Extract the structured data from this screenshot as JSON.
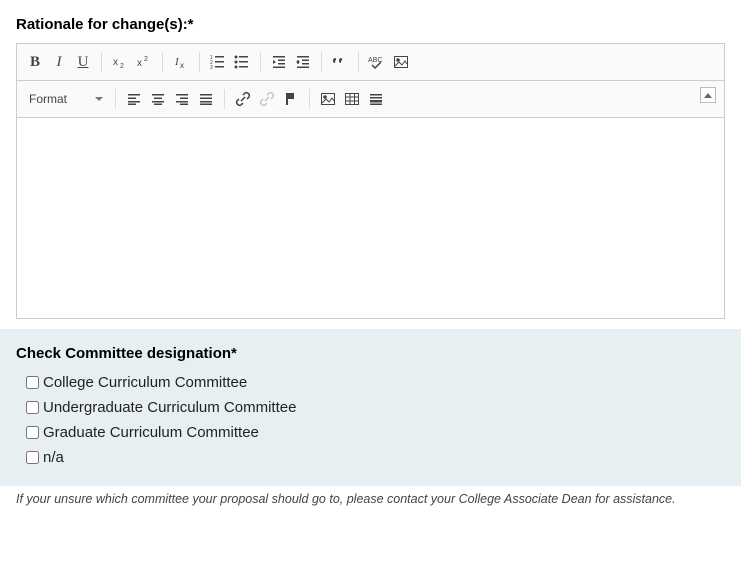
{
  "rationale": {
    "label": "Rationale for change(s):*",
    "value": "",
    "format_label": "Format"
  },
  "committee": {
    "label": "Check Committee designation*",
    "options": [
      {
        "label": "College Curriculum Committee",
        "checked": false
      },
      {
        "label": "Undergraduate Curriculum Committee",
        "checked": false
      },
      {
        "label": "Graduate Curriculum Committee",
        "checked": false
      },
      {
        "label": "n/a",
        "checked": false
      }
    ],
    "help_text": "If your unsure which committee your proposal should go to, please contact your College Associate Dean for assistance."
  }
}
